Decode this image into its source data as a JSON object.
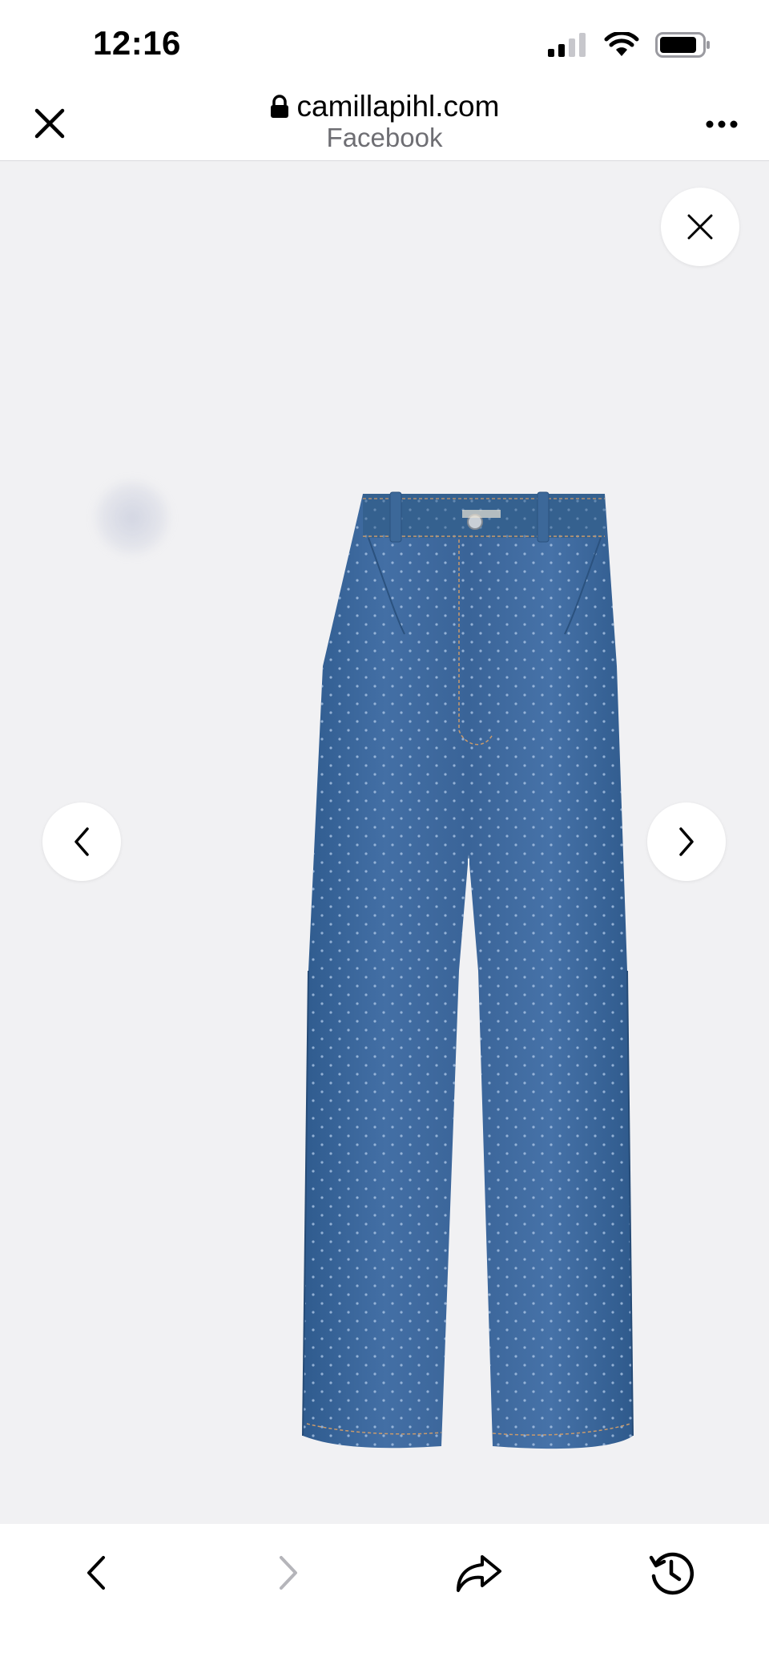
{
  "status_bar": {
    "time": "12:16",
    "icons": [
      "cellular-signal-icon",
      "wifi-icon",
      "battery-icon"
    ]
  },
  "browser": {
    "domain": "camillapihl.com",
    "source": "Facebook",
    "icons": {
      "close": "close-icon",
      "lock": "lock-icon",
      "more": "more-icon"
    }
  },
  "gallery": {
    "icons": {
      "close": "close-icon",
      "previous": "chevron-left-icon",
      "next": "chevron-right-icon"
    },
    "product_image": "blue polka-dot wide-leg jeans",
    "colors": {
      "denim": "#3e6a9e",
      "background": "#f1f1f3"
    }
  },
  "toolbar": {
    "icons": [
      "back-icon",
      "forward-icon",
      "share-icon",
      "history-icon"
    ],
    "forward_enabled": false
  }
}
